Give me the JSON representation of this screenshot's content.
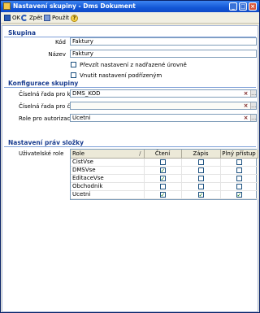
{
  "window": {
    "title": "Nastavení skupiny - Dms Dokument",
    "buttons": {
      "minimize": "_",
      "maximize": "□",
      "close": "×"
    }
  },
  "toolbar": {
    "ok_label": "OK",
    "undo_label": "Zpět",
    "use_label": "Použít",
    "help_label": "?"
  },
  "skupina": {
    "title": "Skupina",
    "kod_label": "Kód",
    "kod_value": "Faktury",
    "nazev_label": "Název",
    "nazev_value": "Faktury",
    "check1_label": "Převzít nastavení z nadřazené úrovně",
    "check2_label": "Vnutit nastavení podřízeným"
  },
  "konfigurace": {
    "title": "Konfigurace skupiny",
    "ciselna_kod_label": "Číselná řada pro kód",
    "ciselna_kod_value": "DMS_KOD",
    "ciselna_cj_label": "Číselná řada pro č.j.",
    "ciselna_cj_value": "",
    "role_label": "Role pro autorizaci",
    "role_value": "Ucetni"
  },
  "prava": {
    "title": "Nastavení práv složky",
    "roles_label": "Uživatelské role",
    "columns": [
      "Role",
      "Čtení",
      "Zápis",
      "Plný přístup"
    ],
    "rows": [
      {
        "role": "CistVse",
        "cteni": false,
        "zapis": false,
        "plny": false
      },
      {
        "role": "DMSVse",
        "cteni": true,
        "zapis": false,
        "plny": false
      },
      {
        "role": "EditaceVse",
        "cteni": true,
        "zapis": false,
        "plny": false
      },
      {
        "role": "Obchodnik",
        "cteni": false,
        "zapis": false,
        "plny": false
      },
      {
        "role": "Ucetni",
        "cteni": true,
        "zapis": true,
        "plny": true
      }
    ]
  },
  "icons": {
    "clear": "×",
    "pick": "…",
    "check": "✓",
    "sort": "/"
  }
}
